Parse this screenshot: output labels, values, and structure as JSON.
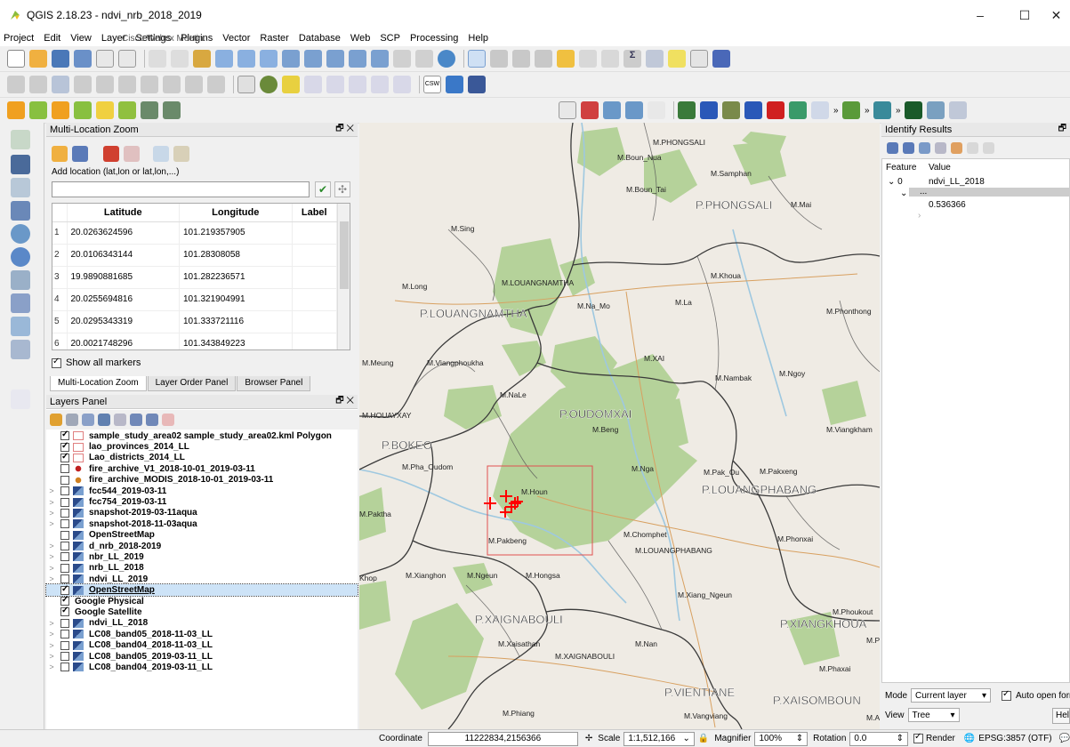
{
  "window": {
    "title": "QGIS 2.18.23 - ndvi_nrb_2018_2019",
    "controls": [
      "–",
      "☐",
      "✕"
    ]
  },
  "menu": [
    "Project",
    "Edit",
    "View",
    "Layer",
    "Settings",
    "Plugins",
    "Vector",
    "Raster",
    "Database",
    "Web",
    "SCP",
    "Processing",
    "Help"
  ],
  "webex_overlay": "Cisco Webex Meetin...",
  "multi_location_zoom": {
    "title": "Multi-Location Zoom",
    "add_label": "Add location (lat,lon or lat,lon,...)",
    "input_value": "",
    "columns": [
      "Latitude",
      "Longitude",
      "Label"
    ],
    "rows": [
      {
        "n": "1",
        "lat": "20.0263624596",
        "lon": "101.219357905",
        "label": ""
      },
      {
        "n": "2",
        "lat": "20.0106343144",
        "lon": "101.28308058",
        "label": ""
      },
      {
        "n": "3",
        "lat": "19.9890881685",
        "lon": "101.282236571",
        "label": ""
      },
      {
        "n": "4",
        "lat": "20.0255694816",
        "lon": "101.321904991",
        "label": ""
      },
      {
        "n": "5",
        "lat": "20.0295343319",
        "lon": "101.333721116",
        "label": ""
      },
      {
        "n": "6",
        "lat": "20.0021748296",
        "lon": "101.343849223",
        "label": ""
      }
    ],
    "show_all_markers": "Show all markers",
    "tabs": [
      "Multi-Location Zoom",
      "Layer Order Panel",
      "Browser Panel"
    ]
  },
  "layers_panel": {
    "title": "Layers Panel",
    "layers": [
      {
        "name": "sample_study_area02 sample_study_area02.kml Polygon",
        "checked": true,
        "sym": "poly-white",
        "exp": ""
      },
      {
        "name": "lao_provinces_2014_LL",
        "checked": true,
        "sym": "poly-white",
        "exp": ""
      },
      {
        "name": "Lao_districts_2014_LL",
        "checked": true,
        "sym": "poly-white",
        "exp": ""
      },
      {
        "name": "fire_archive_V1_2018-10-01_2019-03-11",
        "checked": false,
        "sym": "point-red",
        "exp": ""
      },
      {
        "name": "fire_archive_MODIS_2018-10-01_2019-03-11",
        "checked": false,
        "sym": "point-orange",
        "exp": ""
      },
      {
        "name": "fcc544_2019-03-11",
        "checked": false,
        "sym": "raster",
        "exp": ">"
      },
      {
        "name": "fcc754_2019-03-11",
        "checked": false,
        "sym": "raster",
        "exp": ">"
      },
      {
        "name": "snapshot-2019-03-11aqua",
        "checked": false,
        "sym": "raster",
        "exp": ">"
      },
      {
        "name": "snapshot-2018-11-03aqua",
        "checked": false,
        "sym": "raster",
        "exp": ">"
      },
      {
        "name": "OpenStreetMap",
        "checked": false,
        "sym": "raster",
        "exp": ""
      },
      {
        "name": "d_nrb_2018-2019",
        "checked": false,
        "sym": "raster",
        "exp": ">"
      },
      {
        "name": "nbr_LL_2019",
        "checked": false,
        "sym": "raster",
        "exp": ">"
      },
      {
        "name": "nrb_LL_2018",
        "checked": false,
        "sym": "raster",
        "exp": ">"
      },
      {
        "name": "ndvi_LL_2019",
        "checked": false,
        "sym": "raster",
        "exp": ">"
      },
      {
        "name": "OpenStreetMap",
        "checked": true,
        "sym": "raster",
        "exp": "",
        "selected": true
      },
      {
        "name": "Google Physical",
        "checked": true,
        "sym": "none",
        "exp": ""
      },
      {
        "name": "Google Satellite",
        "checked": true,
        "sym": "none",
        "exp": ""
      },
      {
        "name": "ndvi_LL_2018",
        "checked": false,
        "sym": "raster",
        "exp": ">"
      },
      {
        "name": "LC08_band05_2018-11-03_LL",
        "checked": false,
        "sym": "raster",
        "exp": ">"
      },
      {
        "name": "LC08_band04_2018-11-03_LL",
        "checked": false,
        "sym": "raster",
        "exp": ">"
      },
      {
        "name": "LC08_band05_2019-03-11_LL",
        "checked": false,
        "sym": "raster",
        "exp": ">"
      },
      {
        "name": "LC08_band04_2019-03-11_LL",
        "checked": false,
        "sym": "raster",
        "exp": ">"
      }
    ]
  },
  "map": {
    "labels": [
      {
        "t": "M.PHONGSALI",
        "cls": "dist"
      },
      {
        "t": "M.Boun_Nua",
        "cls": "dist"
      },
      {
        "t": "M.Samphan",
        "cls": "dist"
      },
      {
        "t": "M.Boun_Tai",
        "cls": "dist"
      },
      {
        "t": "P.PHONGSALI",
        "cls": "prov"
      },
      {
        "t": "M.Mai",
        "cls": "dist"
      },
      {
        "t": "M.Sing",
        "cls": "dist"
      },
      {
        "t": "M.Khoua",
        "cls": "dist"
      },
      {
        "t": "M.LOUANGNAMTHA",
        "cls": "dist"
      },
      {
        "t": "M.Long",
        "cls": "dist"
      },
      {
        "t": "P.LOUANGNAMTHA",
        "cls": "prov"
      },
      {
        "t": "M.Na_Mo",
        "cls": "dist"
      },
      {
        "t": "M.La",
        "cls": "dist"
      },
      {
        "t": "M.Phonthong",
        "cls": "dist"
      },
      {
        "t": "M.Meung",
        "cls": "dist"
      },
      {
        "t": "M.Viangphoukha",
        "cls": "dist"
      },
      {
        "t": "M.XAI",
        "cls": "dist"
      },
      {
        "t": "M.Nambak",
        "cls": "dist"
      },
      {
        "t": "M.Ngoy",
        "cls": "dist"
      },
      {
        "t": "M.NaLe",
        "cls": "dist"
      },
      {
        "t": "M.HOUAYXAY",
        "cls": "dist"
      },
      {
        "t": "P.OUDOMXAI",
        "cls": "prov"
      },
      {
        "t": "M.Beng",
        "cls": "dist"
      },
      {
        "t": "M.Viangkham",
        "cls": "dist"
      },
      {
        "t": "P.BOKEO",
        "cls": "prov"
      },
      {
        "t": "M.Pha_Oudom",
        "cls": "dist"
      },
      {
        "t": "M.Nga",
        "cls": "dist"
      },
      {
        "t": "M.Pak_Ou",
        "cls": "dist"
      },
      {
        "t": "M.Pakxeng",
        "cls": "dist"
      },
      {
        "t": "M.Houn",
        "cls": "dist"
      },
      {
        "t": "P.LOUANGPHABANG",
        "cls": "prov"
      },
      {
        "t": "M.Paktha",
        "cls": "dist"
      },
      {
        "t": "M.Pakbeng",
        "cls": "dist"
      },
      {
        "t": "M.Chomphet",
        "cls": "dist"
      },
      {
        "t": "M.LOUANGPHABANG",
        "cls": "dist"
      },
      {
        "t": "M.Phonxai",
        "cls": "dist"
      },
      {
        "t": "M.Xianghon",
        "cls": "dist"
      },
      {
        "t": "M.Ngeun",
        "cls": "dist"
      },
      {
        "t": "M.Hongsa",
        "cls": "dist"
      },
      {
        "t": "Khop",
        "cls": "dist"
      },
      {
        "t": "M.Xiang_Ngeun",
        "cls": "dist"
      },
      {
        "t": "P.XAIGNABOULI",
        "cls": "prov"
      },
      {
        "t": "M.Phoukout",
        "cls": "dist"
      },
      {
        "t": "P.XIANGKHOUA",
        "cls": "prov"
      },
      {
        "t": "M.Xaisathan",
        "cls": "dist"
      },
      {
        "t": "M.Nan",
        "cls": "dist"
      },
      {
        "t": "M.XAIGNABOULI",
        "cls": "dist"
      },
      {
        "t": "M.Phaxai",
        "cls": "dist"
      },
      {
        "t": "P.VIENTIANE",
        "cls": "prov"
      },
      {
        "t": "P.XAISOMBOUN",
        "cls": "prov"
      },
      {
        "t": "M.Phiang",
        "cls": "dist"
      },
      {
        "t": "M.Vangviang",
        "cls": "dist"
      },
      {
        "t": "M.PE",
        "cls": "dist"
      },
      {
        "t": "M.Ann",
        "cls": "dist"
      }
    ],
    "colors": {
      "land": "#efebe4",
      "forest": "#b7d49a",
      "water": "#aad3df",
      "border": "#3a3a3a",
      "study_area": "#e05050",
      "fire": "#ff0000"
    }
  },
  "identify": {
    "title": "Identify Results",
    "col_feature": "Feature",
    "col_value": "Value",
    "feature_index": "0",
    "layer_value": "ndvi_LL_2018",
    "ellipsis": "...",
    "value": "0.536366",
    "mode_label": "Mode",
    "mode_value": "Current layer",
    "auto_open": "Auto open form",
    "view_label": "View",
    "view_value": "Tree",
    "help": "Help"
  },
  "status": {
    "coordinate_label": "Coordinate",
    "coordinate_value": "11222834,2156366",
    "scale_label": "Scale",
    "scale_value": "1:1,512,166",
    "magnifier_label": "Magnifier",
    "magnifier_value": "100%",
    "rotation_label": "Rotation",
    "rotation_value": "0.0",
    "render_label": "Render",
    "crs": "EPSG:3857 (OTF)"
  }
}
